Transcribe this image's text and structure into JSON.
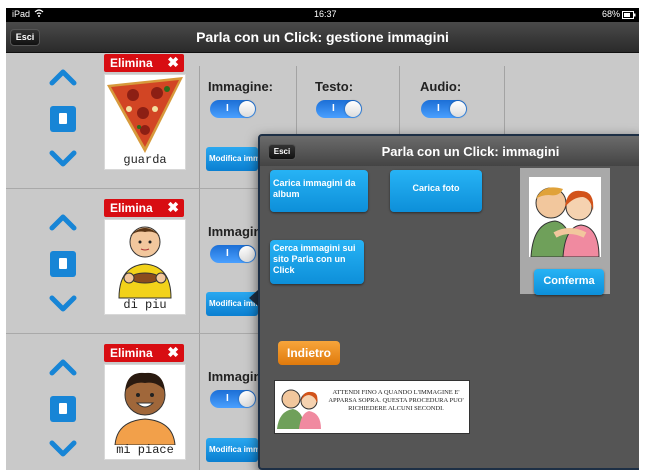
{
  "status_bar": {
    "device": "iPad",
    "time": "16:37",
    "battery": "68%"
  },
  "nav": {
    "esc_label": "Esci",
    "title": "Parla con un Click: gestione immagini"
  },
  "columns": {
    "immagine": "Immagine:",
    "testo": "Testo:",
    "audio": "Audio:"
  },
  "toggle_on_label": "I",
  "rows": [
    {
      "elimina": "Elimina",
      "word": "guarda",
      "modifica": "Modifica immagine"
    },
    {
      "elimina": "Elimina",
      "word": "di piu",
      "modifica": "Modifica immagine"
    },
    {
      "elimina": "Elimina",
      "word": "mi piace",
      "modifica": "Modifica immagine"
    }
  ],
  "dialog": {
    "esc_label": "Esci",
    "title": "Parla con un Click: immagini",
    "load_album": "Carica immagini da album",
    "load_photo": "Carica foto",
    "search_site": "Cerca immagini sui sito Parla con un Click",
    "confirm": "Conferma",
    "back": "Indietro",
    "notice": "ATTENDI FINO A QUANDO L'IMMAGINE E' APPARSA SOPRA. QUESTA PROCEDURA PUO' RICHIEDERE ALCUNI SECONDI."
  },
  "colors": {
    "accent_blue": "#1785d6",
    "delete_red": "#d80d12",
    "back_orange": "#f0901f",
    "toggle_blue": "#2b86ee"
  },
  "icons": [
    "wifi-icon",
    "battery-icon",
    "chevron-up-icon",
    "chevron-down-icon",
    "document-icon",
    "close-x-icon"
  ]
}
